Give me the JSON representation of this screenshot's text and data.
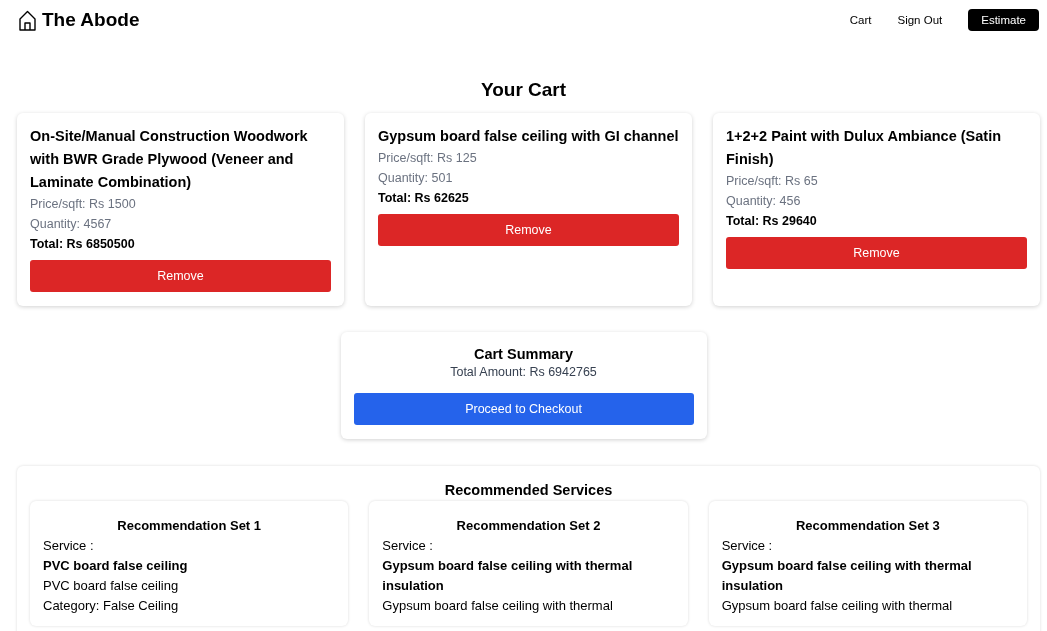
{
  "header": {
    "brand": "The Abode",
    "nav": [
      {
        "label": "Cart",
        "kind": "link"
      },
      {
        "label": "Sign Out",
        "kind": "link"
      },
      {
        "label": "Estimate",
        "kind": "button"
      }
    ]
  },
  "cart": {
    "title": "Your Cart",
    "items": [
      {
        "name": "On-Site/Manual Construction Woodwork with BWR Grade Plywood (Veneer and Laminate Combination)",
        "price": "Price/sqft: Rs 1500",
        "quantity": "Quantity: 4567",
        "total": "Total: Rs 6850500",
        "button": "Remove"
      },
      {
        "name": "Gypsum board false ceiling with GI channel",
        "price": "Price/sqft: Rs 125",
        "quantity": "Quantity: 501",
        "total": "Total: Rs 62625",
        "button": "Remove"
      },
      {
        "name": "1+2+2 Paint with Dulux Ambiance (Satin Finish)",
        "price": "Price/sqft: Rs 65",
        "quantity": "Quantity: 456",
        "total": "Total: Rs 29640",
        "button": "Remove"
      }
    ]
  },
  "summary": {
    "title": "Cart Summary",
    "total": "Total Amount: Rs 6942765",
    "button": "Proceed to Checkout"
  },
  "recommendations": {
    "title": "Recommended Services",
    "sets": [
      {
        "title": "Recommendation Set 1",
        "service_label": "Service :",
        "service": "PVC board false ceiling",
        "description": "PVC board false ceiling",
        "category": "Category: False Ceiling"
      },
      {
        "title": "Recommendation Set 2",
        "service_label": "Service :",
        "service": "Gypsum board false ceiling with thermal insulation",
        "description": "Gypsum board false ceiling with thermal"
      },
      {
        "title": "Recommendation Set 3",
        "service_label": "Service :",
        "service": "Gypsum board false ceiling with thermal insulation",
        "description": "Gypsum board false ceiling with thermal"
      }
    ]
  }
}
